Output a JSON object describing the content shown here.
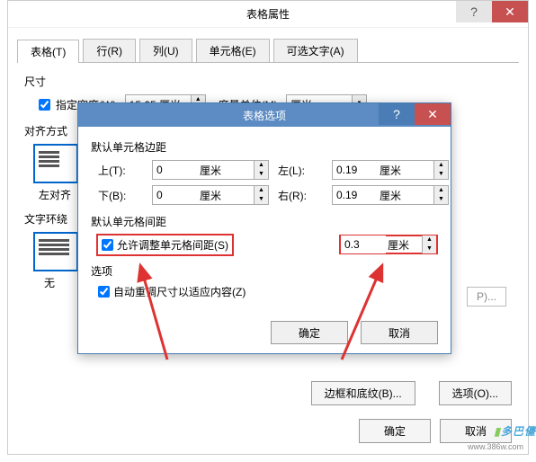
{
  "main": {
    "title": "表格属性",
    "tabs": [
      "表格(T)",
      "行(R)",
      "列(U)",
      "单元格(E)",
      "可选文字(A)"
    ],
    "size_label": "尺寸",
    "specify_width_label": "指定宽度(W):",
    "width_value": "15.05 厘米",
    "measure_unit_label": "度量单位(M):",
    "measure_unit_value": "厘米",
    "align_label": "对齐方式",
    "left_align_label": "左对齐",
    "wrap_label": "文字环绕",
    "none_label": "无",
    "positioning_btn": "P)...",
    "border_btn": "边框和底纹(B)...",
    "options_btn": "选项(O)...",
    "ok_btn": "确定",
    "cancel_btn": "取消"
  },
  "options": {
    "title": "表格选项",
    "margins_label": "默认单元格边距",
    "top_label": "上(T):",
    "bottom_label": "下(B):",
    "left_label": "左(L):",
    "right_label": "右(R):",
    "top_val": "0",
    "bottom_val": "0",
    "left_val": "0.19",
    "right_val": "0.19",
    "unit": "厘米",
    "spacing_label": "默认单元格间距",
    "allow_spacing_label": "允许调整单元格间距(S)",
    "spacing_val": "0.3",
    "opts_label": "选项",
    "auto_resize_label": "自动重调尺寸以适应内容(Z)",
    "ok": "确定",
    "cancel": "取消"
  },
  "watermark": {
    "text": "多巴儓",
    "sub": "www.386w.com"
  }
}
